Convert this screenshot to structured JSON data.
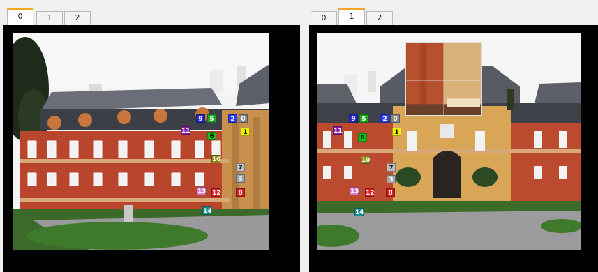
{
  "left_pane": {
    "tabs": [
      {
        "label": "0",
        "active": true
      },
      {
        "label": "1",
        "active": false
      },
      {
        "label": "2",
        "active": false
      }
    ]
  },
  "right_pane": {
    "tabs": [
      {
        "label": "0",
        "active": false
      },
      {
        "label": "1",
        "active": true
      },
      {
        "label": "2",
        "active": false
      }
    ]
  },
  "marker_colors": {
    "1": "#f2f200",
    "2": "#2b3cf5",
    "3": "#9ea5a8",
    "4": "#7a7a7a",
    "5": "#1ea81e",
    "6": "#18c018",
    "7": "#bdbdbd",
    "8": "#d61f1f",
    "9": "#2828c8",
    "10": "#8b8b12",
    "11": "#8c1ea6",
    "12": "#e02020",
    "13": "#d87ad8",
    "14": "#1b8c8c",
    "15": "#6a7ac8"
  },
  "left_markers": [
    {
      "label": "9"
    },
    {
      "label": "5"
    },
    {
      "label": "2"
    },
    {
      "label": "0"
    },
    {
      "label": "11"
    },
    {
      "label": "1"
    },
    {
      "label": "6"
    },
    {
      "label": "10"
    },
    {
      "label": "7"
    },
    {
      "label": "3"
    },
    {
      "label": "12"
    },
    {
      "label": "8"
    },
    {
      "label": "13"
    },
    {
      "label": "14"
    }
  ],
  "right_markers": [
    {
      "label": "9"
    },
    {
      "label": "5"
    },
    {
      "label": "2"
    },
    {
      "label": "0"
    },
    {
      "label": "11"
    },
    {
      "label": "1"
    },
    {
      "label": "6"
    },
    {
      "label": "10"
    },
    {
      "label": "7"
    },
    {
      "label": "3"
    },
    {
      "label": "12"
    },
    {
      "label": "8"
    },
    {
      "label": "13"
    },
    {
      "label": "14"
    }
  ]
}
